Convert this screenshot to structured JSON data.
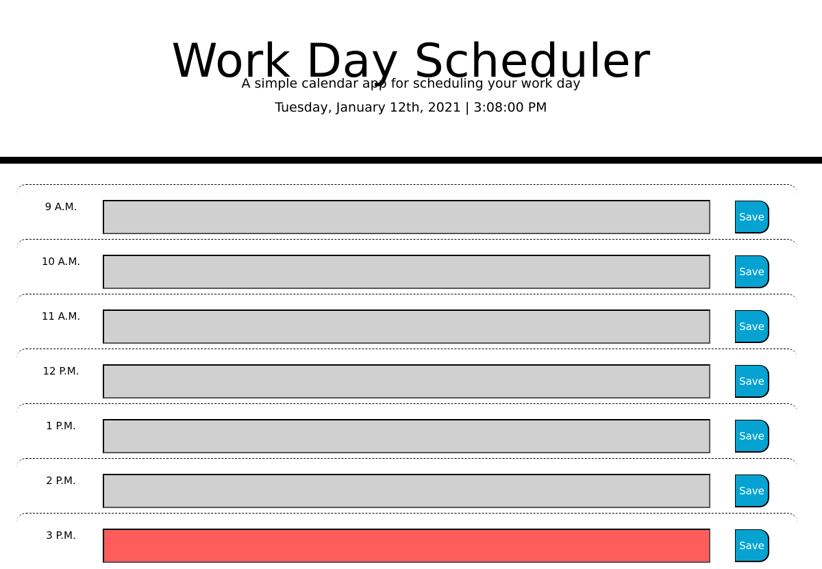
{
  "header": {
    "title": "Work Day Scheduler",
    "subtitle": "A simple calendar app for scheduling your work day",
    "datetime": "Tuesday, January 12th, 2021 | 3:08:00 PM"
  },
  "colors": {
    "past": "#d0d0d0",
    "present": "#ff5c5c",
    "save_button": "#06a3d2"
  },
  "rows": [
    {
      "hour": "9 A.M.",
      "value": "",
      "status": "past",
      "save_label": "Save"
    },
    {
      "hour": "10 A.M.",
      "value": "",
      "status": "past",
      "save_label": "Save"
    },
    {
      "hour": "11 A.M.",
      "value": "",
      "status": "past",
      "save_label": "Save"
    },
    {
      "hour": "12 P.M.",
      "value": "",
      "status": "past",
      "save_label": "Save"
    },
    {
      "hour": "1 P.M.",
      "value": "",
      "status": "past",
      "save_label": "Save"
    },
    {
      "hour": "2 P.M.",
      "value": "",
      "status": "past",
      "save_label": "Save"
    },
    {
      "hour": "3 P.M.",
      "value": "",
      "status": "present",
      "save_label": "Save"
    }
  ]
}
